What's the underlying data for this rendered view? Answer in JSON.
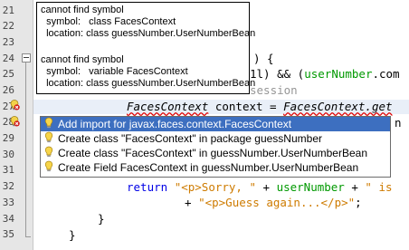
{
  "gutter": {
    "line_numbers": [
      "21",
      "22",
      "23",
      "24",
      "25",
      "26",
      "27",
      "28",
      "29",
      "30",
      "31",
      "32",
      "33",
      "34",
      "35"
    ]
  },
  "code": {
    "l24_tail": ") {",
    "l25_tail": "1l) && (",
    "l25_field": "userNumber",
    "l25_end": ".com",
    "l26_tail": "session",
    "l27_type": "FacesContext",
    "l27_mid": " context = ",
    "l27_call": "FacesContext.get",
    "l28_tail": "n",
    "l32_return": "return",
    "l32_str1": "\"<p>Sorry, \"",
    "l32_plus1": " + ",
    "l32_field": "userNumber",
    "l32_plus2": " + ",
    "l32_str2": "\" is",
    "l33_plus": "+ ",
    "l33_str": "\"<p>Guess again...</p>\"",
    "l33_end": ";",
    "l34_brace": "}",
    "l35_brace": "}"
  },
  "tooltip": {
    "block1_title": "cannot find symbol",
    "block1_symbol": "  symbol:   class FacesContext",
    "block1_location": "  location: class guessNumber.UserNumberBean",
    "block2_title": "cannot find symbol",
    "block2_symbol": "  symbol:   variable FacesContext",
    "block2_location": "  location: class guessNumber.UserNumberBean"
  },
  "hint_popup": {
    "items": [
      "Add import for javax.faces.context.FacesContext",
      "Create class \"FacesContext\" in package guessNumber",
      "Create class \"FacesContext\" in guessNumber.UserNumberBean",
      "Create Field FacesContext in guessNumber.UserNumberBean"
    ]
  },
  "icons": {
    "hint": "lightbulb-icon",
    "error": "error-hint-icon",
    "fold": "fold-collapse-icon"
  },
  "colors": {
    "keyword": "#0000e6",
    "string": "#ce7b00",
    "field": "#009900",
    "selection": "#3d6fc0",
    "gutter": "#e6e6e6"
  }
}
